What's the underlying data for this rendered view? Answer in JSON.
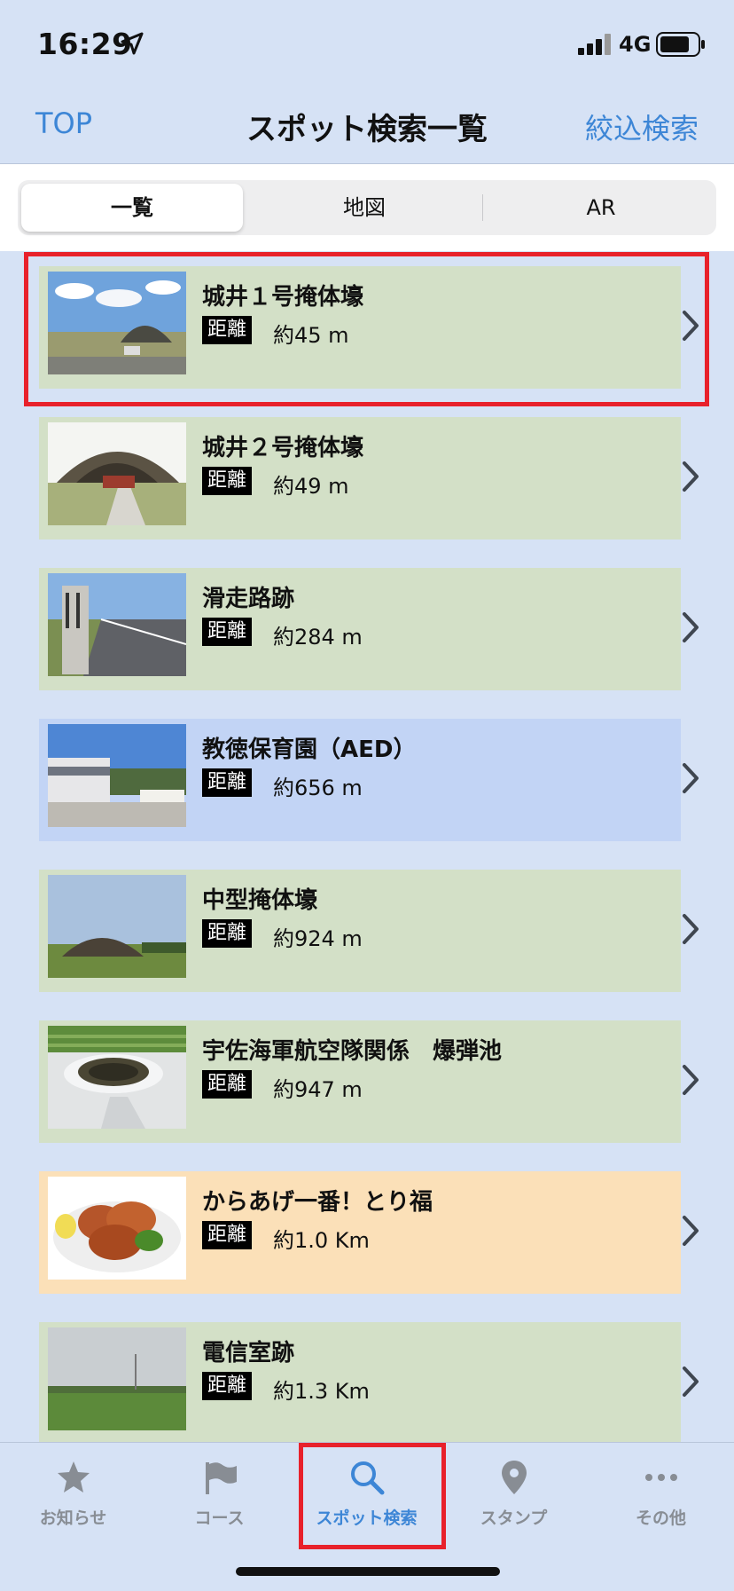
{
  "status_bar": {
    "time": "16:29",
    "network": "4G"
  },
  "nav": {
    "left": "TOP",
    "title": "スポット検索一覧",
    "right": "絞込検索"
  },
  "segments": [
    "一覧",
    "地図",
    "AR"
  ],
  "distance_label": "距離",
  "spots": [
    {
      "name": "城井１号掩体壕",
      "distance": "約45 m"
    },
    {
      "name": "城井２号掩体壕",
      "distance": "約49 m"
    },
    {
      "name": "滑走路跡",
      "distance": "約284 m"
    },
    {
      "name": "教徳保育園（AED）",
      "distance": "約656 m"
    },
    {
      "name": "中型掩体壕",
      "distance": "約924 m"
    },
    {
      "name": "宇佐海軍航空隊関係　爆弾池",
      "distance": "約947 m"
    },
    {
      "name": "からあげ一番！とり福",
      "distance": "約1.0 Km"
    },
    {
      "name": "電信室跡",
      "distance": "約1.3 Km"
    }
  ],
  "tabs": [
    {
      "label": "お知らせ"
    },
    {
      "label": "コース"
    },
    {
      "label": "スポット検索"
    },
    {
      "label": "スタンプ"
    },
    {
      "label": "その他"
    }
  ],
  "colors": {
    "accent": "#3d86d6",
    "highlight": "#e8212b",
    "card_green": "#d3e0c7",
    "card_blue": "#c2d4f5",
    "card_orange": "#fbe0b8"
  }
}
